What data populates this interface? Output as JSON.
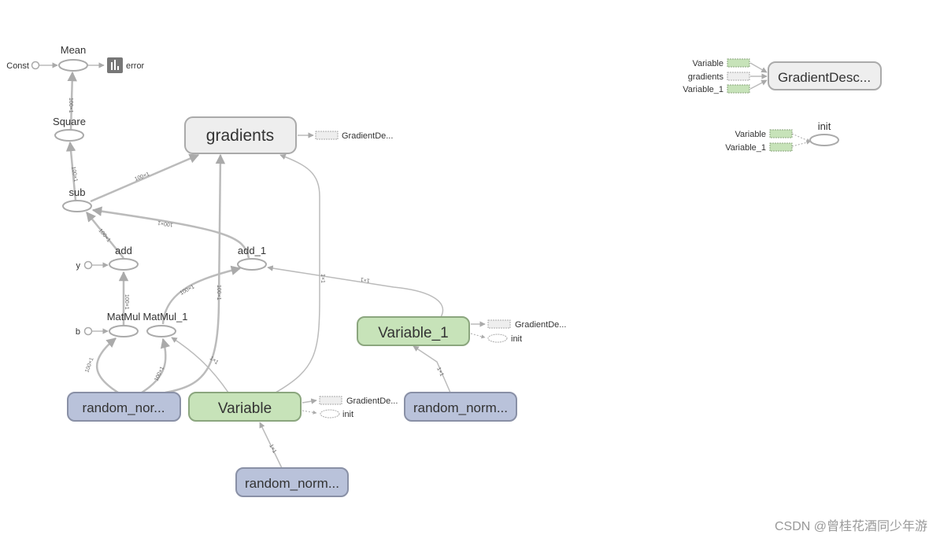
{
  "nodes": {
    "const": "Const",
    "mean": "Mean",
    "error": "error",
    "square": "Square",
    "sub": "sub",
    "gradients": "gradients",
    "gradients_aux": "GradientDe...",
    "add": "add",
    "add_1": "add_1",
    "y": "y",
    "b": "b",
    "matmul": "MatMul",
    "matmul_1": "MatMul_1",
    "random_normal": "random_nor...",
    "variable": "Variable",
    "variable_aux_grad": "GradientDe...",
    "variable_aux_init": "init",
    "random_normal_1": "random_norm...",
    "variable_1": "Variable_1",
    "variable_1_aux_grad": "GradientDe...",
    "variable_1_aux_init": "init",
    "random_normal_2": "random_norm...",
    "gradient_descent": "GradientDesc...",
    "gd_in_variable": "Variable",
    "gd_in_gradients": "gradients",
    "gd_in_variable_1": "Variable_1",
    "init": "init",
    "init_in_variable": "Variable",
    "init_in_variable_1": "Variable_1"
  },
  "edge_labels": {
    "square_mean": "100×1",
    "sub_square": "100×1",
    "sub_gradients": "100×1",
    "add1_sub": "100×1",
    "add_sub": "100×1",
    "matmul_add": "100×1",
    "rn_matmul": "100×1",
    "rn_matmul1": "100×1",
    "matmul1_add1": "100×1",
    "rn_gradients": "100×1",
    "var_matmul1": "1×1",
    "var_gradients": "1×1",
    "var1_add1": "1×1",
    "rn2_var1": "1×1",
    "rn1_var": "1×1"
  },
  "watermark": "CSDN @曾桂花酒同少年游",
  "colors": {
    "op": "#eeeeee",
    "random": "#b9c2da",
    "variable": "#c7e3b9"
  }
}
